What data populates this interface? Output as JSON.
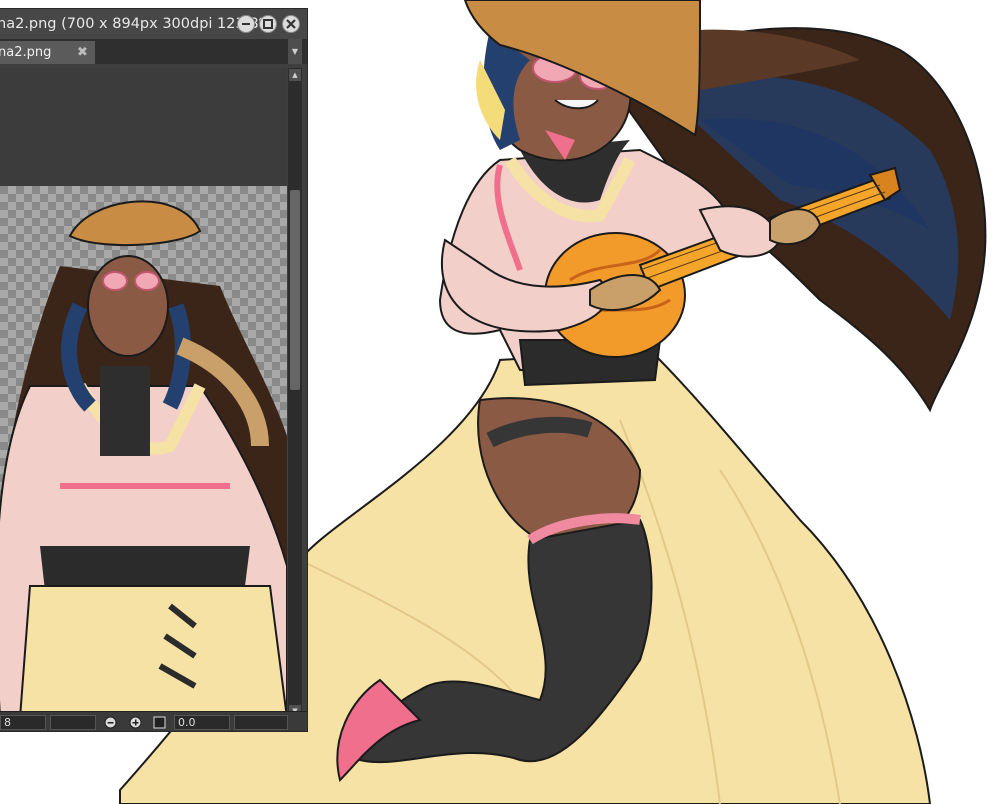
{
  "window": {
    "title": "na2.png (700 x 894px 300dpi 123.8%",
    "tab_label": "na2.png",
    "tab_close": "✖",
    "tab_menu": "▼"
  },
  "statusbar": {
    "zoom_field": "8",
    "angle_field": "0.0"
  },
  "icons": [
    "minimize-icon",
    "maximize-icon",
    "close-icon",
    "zoom-out-icon",
    "zoom-in-icon",
    "fit-icon"
  ],
  "colors": {
    "window_bg": "#3f3f3f",
    "titlebar": "#474747",
    "tab_active": "#5b5b5b",
    "skirt": "#f6e2a4",
    "blouse": "#f2cfc9",
    "accent_pink": "#ef6f8c",
    "hat": "#c98c45",
    "lute": "#f39b2a"
  }
}
